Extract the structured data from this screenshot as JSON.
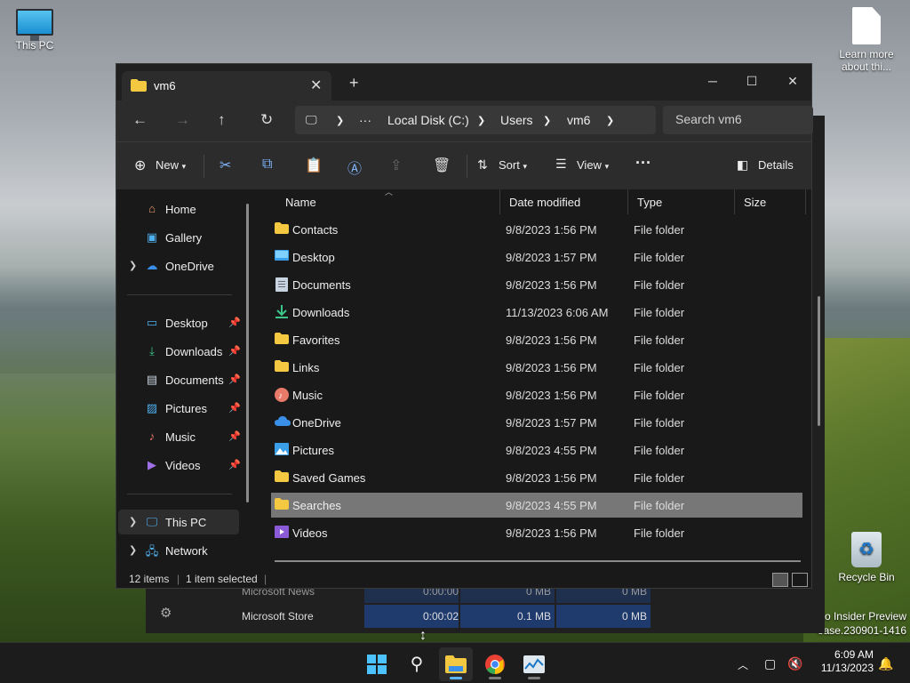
{
  "desktop": {
    "icons": {
      "this_pc": "This PC",
      "learn_more": "Learn more about thi...",
      "recycle_bin": "Recycle Bin"
    },
    "watermark_line1": "ro Insider Preview",
    "watermark_line2": "ease.230901-1416"
  },
  "background_window": {
    "rows": [
      {
        "name": "Microsoft News",
        "time": "0:00:00",
        "mem": "0 MB",
        "net": "0 MB"
      },
      {
        "name": "Microsoft Store",
        "time": "0:00:02",
        "mem": "0.1 MB",
        "net": "0 MB"
      }
    ]
  },
  "explorer": {
    "tab_title": "vm6",
    "address": {
      "segments": [
        "Local Disk (C:)",
        "Users",
        "vm6"
      ],
      "overflow": "···"
    },
    "search_placeholder": "Search vm6",
    "toolbar": {
      "new_label": "New",
      "sort_label": "Sort",
      "view_label": "View",
      "more_label": "···",
      "details_label": "Details"
    },
    "nav": {
      "home": "Home",
      "gallery": "Gallery",
      "onedrive": "OneDrive",
      "desktop": "Desktop",
      "downloads": "Downloads",
      "documents": "Documents",
      "pictures": "Pictures",
      "music": "Music",
      "videos": "Videos",
      "this_pc": "This PC",
      "network": "Network"
    },
    "columns": {
      "name": "Name",
      "date": "Date modified",
      "type": "Type",
      "size": "Size"
    },
    "files": [
      {
        "name": "Contacts",
        "date": "9/8/2023 1:56 PM",
        "type": "File folder",
        "icon": "folder-icon"
      },
      {
        "name": "Desktop",
        "date": "9/8/2023 1:57 PM",
        "type": "File folder",
        "icon": "desktop-folder-icon"
      },
      {
        "name": "Documents",
        "date": "9/8/2023 1:56 PM",
        "type": "File folder",
        "icon": "documents-folder-icon"
      },
      {
        "name": "Downloads",
        "date": "11/13/2023 6:06 AM",
        "type": "File folder",
        "icon": "downloads-folder-icon"
      },
      {
        "name": "Favorites",
        "date": "9/8/2023 1:56 PM",
        "type": "File folder",
        "icon": "folder-icon"
      },
      {
        "name": "Links",
        "date": "9/8/2023 1:56 PM",
        "type": "File folder",
        "icon": "folder-icon"
      },
      {
        "name": "Music",
        "date": "9/8/2023 1:56 PM",
        "type": "File folder",
        "icon": "music-folder-icon"
      },
      {
        "name": "OneDrive",
        "date": "9/8/2023 1:57 PM",
        "type": "File folder",
        "icon": "onedrive-folder-icon"
      },
      {
        "name": "Pictures",
        "date": "9/8/2023 4:55 PM",
        "type": "File folder",
        "icon": "pictures-folder-icon"
      },
      {
        "name": "Saved Games",
        "date": "9/8/2023 1:56 PM",
        "type": "File folder",
        "icon": "folder-icon"
      },
      {
        "name": "Searches",
        "date": "9/8/2023 4:55 PM",
        "type": "File folder",
        "icon": "folder-icon",
        "selected": true
      },
      {
        "name": "Videos",
        "date": "9/8/2023 1:56 PM",
        "type": "File folder",
        "icon": "videos-folder-icon"
      }
    ],
    "status": {
      "count": "12 items",
      "selected": "1 item selected"
    }
  },
  "taskbar": {
    "time": "6:09 AM",
    "date": "11/13/2023"
  },
  "colors": {
    "folder_yellow": "#f5c842",
    "accent_blue": "#5ab6ff",
    "selected_row": "#777777"
  }
}
